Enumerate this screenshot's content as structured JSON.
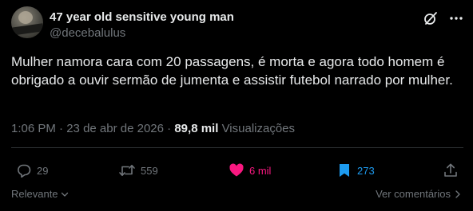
{
  "author": {
    "name": "47 year old sensitive young man",
    "handle": "@decebalulus"
  },
  "tweet": {
    "text": "Mulher namora cara com 20 passagens, é morta e agora todo homem é obrigado a ouvir sermão de jumenta e assistir futebol narrado por mulher."
  },
  "meta": {
    "time": "1:06 PM",
    "separator1": " · ",
    "date": "23 de abr de 2026",
    "separator2": " · ",
    "views_count": "89,8 mil",
    "views_label": "Visualizações"
  },
  "actions": {
    "replies": "29",
    "retweets": "559",
    "likes": "6 mil",
    "bookmarks": "273"
  },
  "footer": {
    "sort_label": "Relevante",
    "see_replies_label": "Ver comentários"
  },
  "colors": {
    "background": "#000000",
    "text": "#e7e9ea",
    "muted": "#71767b",
    "like_active": "#f91880",
    "bookmark_active": "#1d9bf0"
  },
  "icons": [
    "avatar-image",
    "grok-icon",
    "more-icon",
    "reply-icon",
    "retweet-icon",
    "heart-icon",
    "bookmark-icon",
    "share-icon",
    "chevron-down-icon",
    "chevron-right-icon"
  ]
}
